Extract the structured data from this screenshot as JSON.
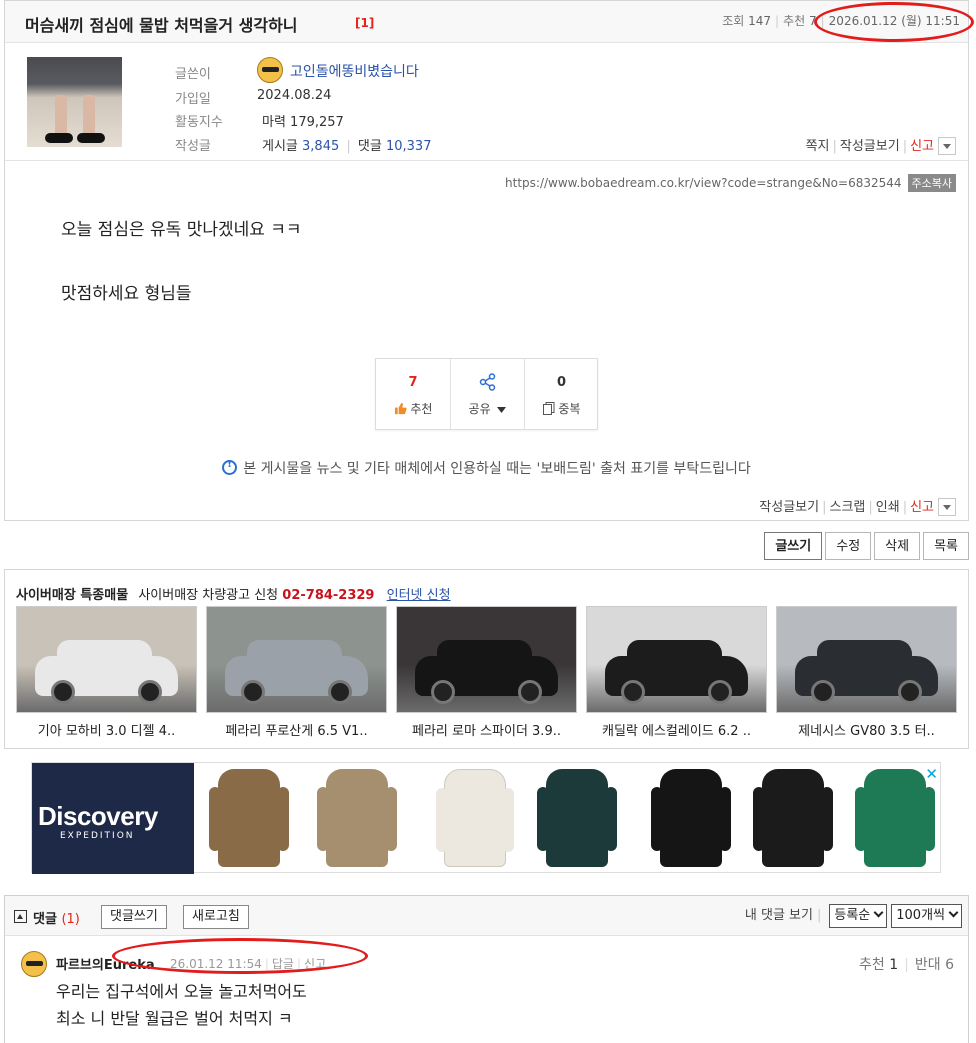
{
  "post": {
    "title": "머슴새끼 점심에 물밥 처먹을거 생각하니",
    "comment_count_badge": "[1]",
    "views_label": "조회",
    "views": "147",
    "recommend_label": "추천",
    "recommend": "7",
    "datetime": "2026.01.12 (월) 11:51"
  },
  "author": {
    "label_writer": "글쓴이",
    "nickname": "고인돌에똥비볐습니다",
    "label_joined": "가입일",
    "joined": "2024.08.24",
    "label_activity": "활동지수",
    "activity": "마력 179,257",
    "label_posts": "작성글",
    "posts_label": "게시글",
    "posts_count": "3,845",
    "comments_label": "댓글",
    "comments_count": "10,337",
    "actions": [
      "쪽지",
      "작성글보기",
      "신고"
    ]
  },
  "url": {
    "text": "https://www.bobaedream.co.kr/view?code=strange&No=6832544",
    "copy_label": "주소복사"
  },
  "body": {
    "line1": "오늘 점심은 유독 맛나겠네요 ㅋㅋ",
    "line2": "맛점하세요 형님들"
  },
  "votes": {
    "recommend_count": "7",
    "recommend_label": "추천",
    "share_label": "공유",
    "duplicate_count": "0",
    "duplicate_label": "중복"
  },
  "notice": "본 게시물을 뉴스 및 기타 매체에서 인용하실 때는 '보배드림' 출처 표기를 부탁드립니다",
  "post_actions": [
    "작성글보기",
    "스크랩",
    "인쇄",
    "신고"
  ],
  "buttons": [
    "글쓰기",
    "수정",
    "삭제",
    "목록"
  ],
  "cyber": {
    "title": "사이버매장 특종매물",
    "ad_text": "사이버매장 차량광고 신청",
    "phone": "02-784-2329",
    "link": "인터넷 신청",
    "cars": [
      {
        "name": "기아 모하비 3.0 디젤 4..",
        "color": "#e8e8e8"
      },
      {
        "name": "페라리 푸로산게 6.5 V1..",
        "color": "#9aa1a8"
      },
      {
        "name": "페라리 로마 스파이더 3.9..",
        "color": "#151515"
      },
      {
        "name": "캐딜락 에스컬레이드 6.2 ..",
        "color": "#1c1c1c"
      },
      {
        "name": "제네시스 GV80 3.5 터..",
        "color": "#2a2e33"
      }
    ]
  },
  "ad": {
    "brand": "Discovery",
    "sub": "EXPEDITION",
    "close_icon": "✕",
    "jackets": [
      "#8a6b47",
      "#a58f6e",
      "#ece8df",
      "#1d3a3a",
      "#151515",
      "#1b1b1b",
      "#1e7a55"
    ]
  },
  "comments": {
    "title": "댓글",
    "count": "(1)",
    "write_button": "댓글쓰기",
    "refresh_button": "새로고침",
    "my_comments": "내 댓글 보기",
    "sort_select": "등록순",
    "per_page_select": "100개씩",
    "items": [
      {
        "author": "파르브의Eureka",
        "datetime": "26.01.12 11:54",
        "reply": "답글",
        "report": "신고",
        "recommend_label": "추천",
        "recommend": "1",
        "oppose_label": "반대",
        "oppose": "6",
        "line1": "우리는 집구석에서 오늘 놀고처먹어도",
        "line2": "최소 니 반달 월급은 벌어 처먹지 ㅋ"
      }
    ]
  }
}
